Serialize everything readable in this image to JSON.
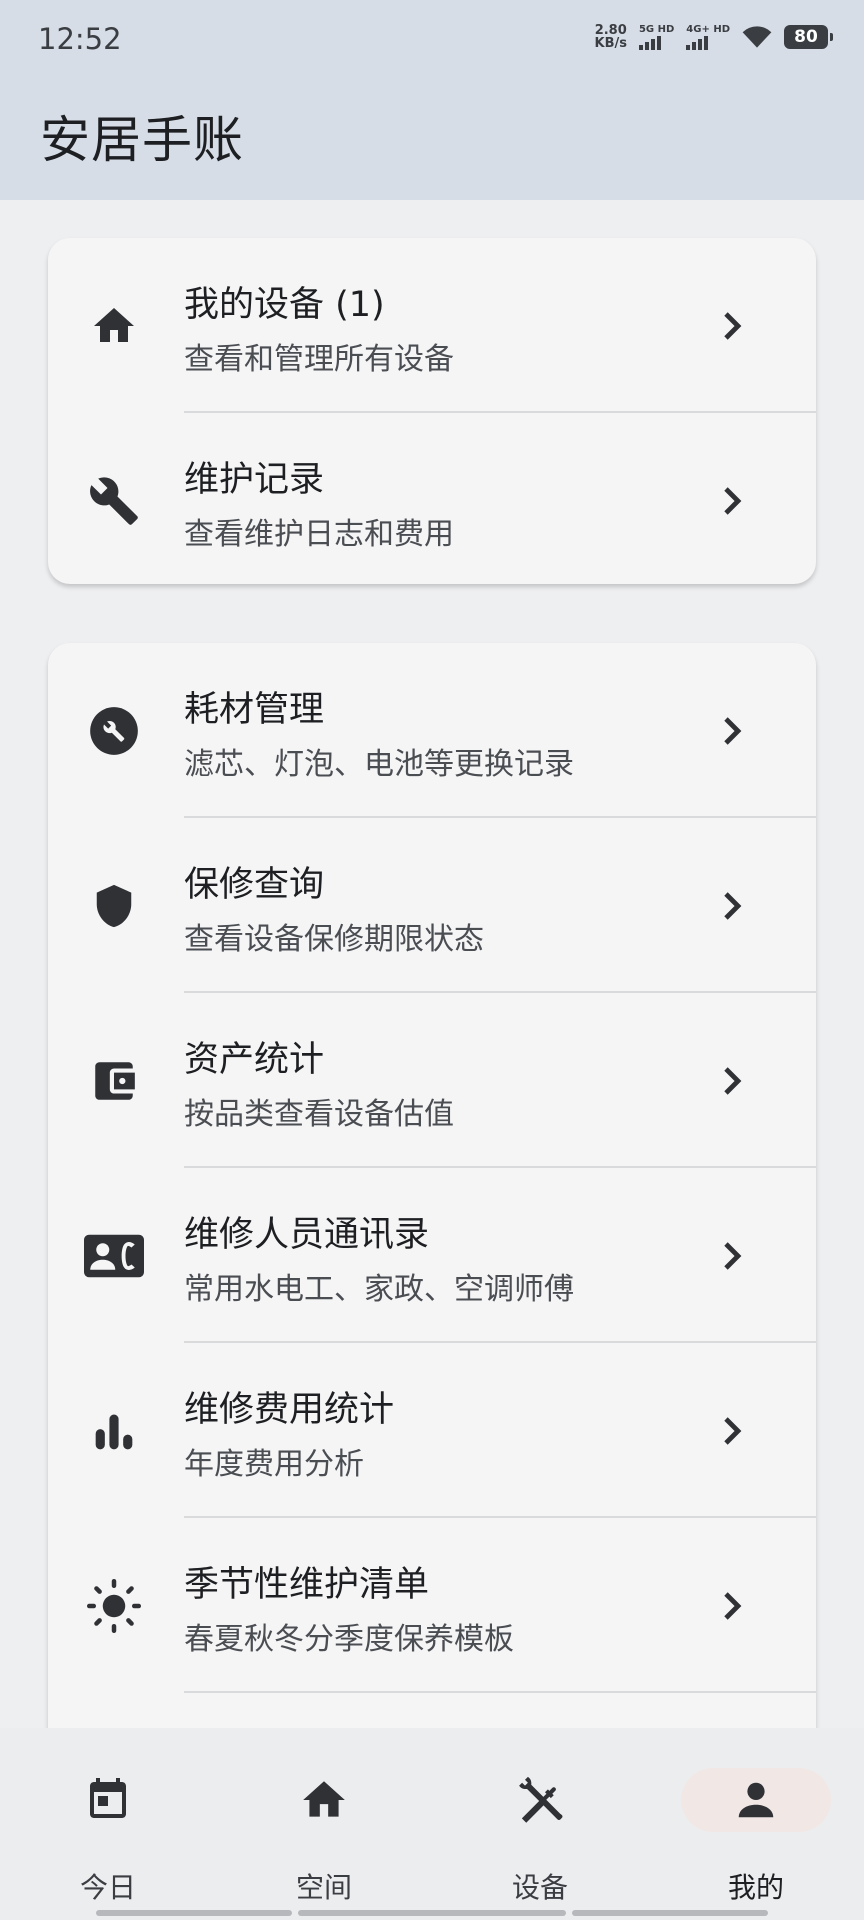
{
  "status_bar": {
    "time": "12:52",
    "net_speed_value": "2.80",
    "net_speed_unit": "KB/s",
    "sim1_label": "5G HD",
    "sim2_label": "4G+ HD",
    "battery": "80"
  },
  "app_title": "安居手账",
  "card1": {
    "items": [
      {
        "title": "我的设备 (1)",
        "subtitle": "查看和管理所有设备",
        "icon": "home-icon"
      },
      {
        "title": "维护记录",
        "subtitle": "查看维护日志和费用",
        "icon": "wrench-icon"
      }
    ]
  },
  "card2": {
    "items": [
      {
        "title": "耗材管理",
        "subtitle": "滤芯、灯泡、电池等更换记录",
        "icon": "build-circle-icon"
      },
      {
        "title": "保修查询",
        "subtitle": "查看设备保修期限状态",
        "icon": "shield-icon"
      },
      {
        "title": "资产统计",
        "subtitle": "按品类查看设备估值",
        "icon": "wallet-icon"
      },
      {
        "title": "维修人员通讯录",
        "subtitle": "常用水电工、家政、空调师傅",
        "icon": "contact-phone-icon"
      },
      {
        "title": "维修费用统计",
        "subtitle": "年度费用分析",
        "icon": "bar-chart-icon"
      },
      {
        "title": "季节性维护清单",
        "subtitle": "春夏秋冬分季度保养模板",
        "icon": "sun-icon"
      }
    ]
  },
  "bottom_nav": {
    "items": [
      {
        "label": "今日",
        "icon": "calendar-icon"
      },
      {
        "label": "空间",
        "icon": "home-icon"
      },
      {
        "label": "设备",
        "icon": "tools-icon"
      },
      {
        "label": "我的",
        "icon": "person-icon"
      }
    ],
    "active": "我的"
  },
  "colors": {
    "header_bg": "#d6dde6",
    "page_bg": "#eeeff1",
    "card_bg": "#f5f5f6",
    "icon": "#2f3135",
    "active_nav_pill": "#f1e8e6"
  }
}
